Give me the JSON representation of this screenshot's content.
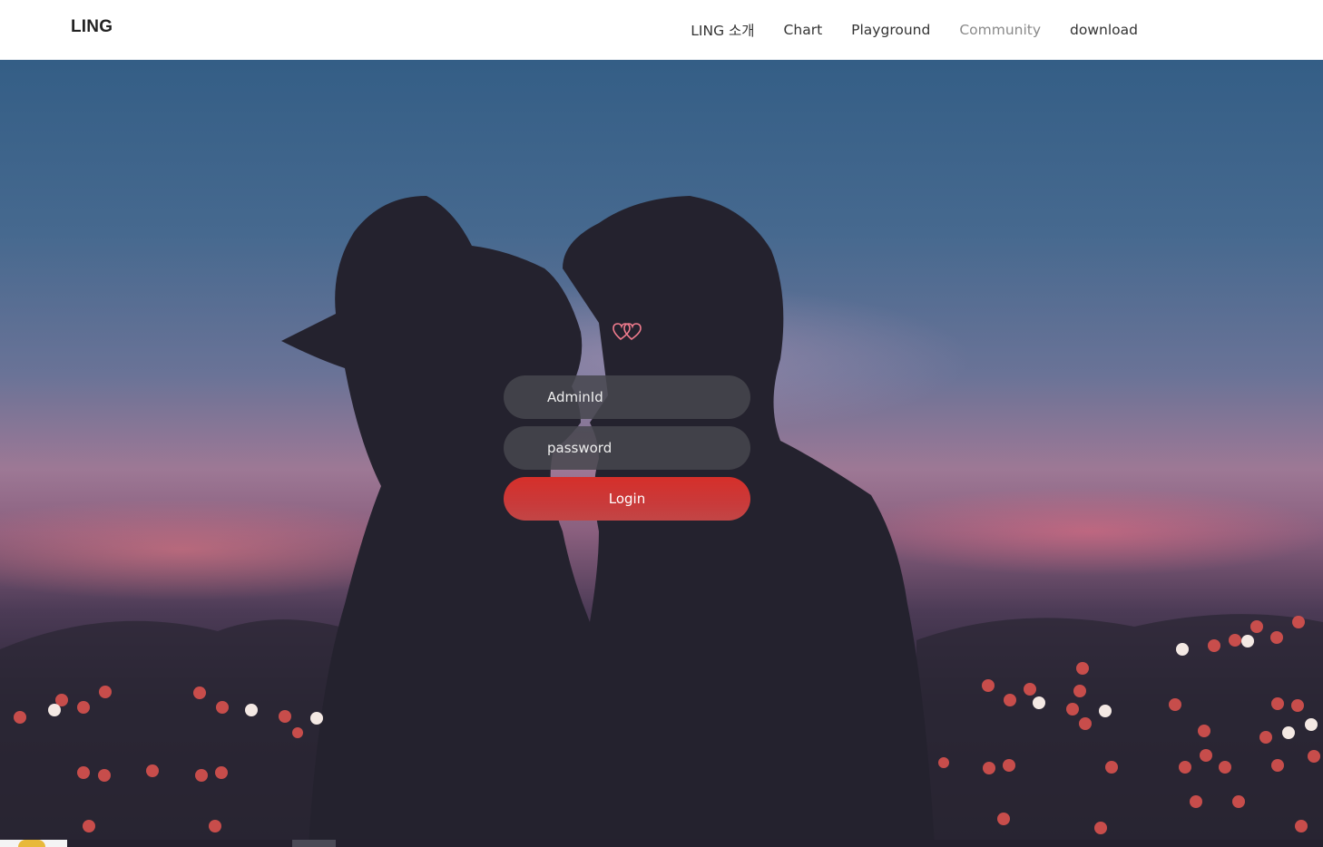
{
  "header": {
    "brand": "LING",
    "nav": [
      {
        "label": "LING 소개"
      },
      {
        "label": "Chart"
      },
      {
        "label": "Playground"
      },
      {
        "label": "Community"
      },
      {
        "label": "download"
      }
    ]
  },
  "login": {
    "adminid_placeholder": "AdminId",
    "password_placeholder": "password",
    "login_label": "Login"
  },
  "logo_icon": "double-heart-icon",
  "colors": {
    "login_button": "#d62f2a",
    "input_background": "#46464e",
    "header_background": "#ffffff",
    "nav_muted": "#8a8a8a"
  }
}
